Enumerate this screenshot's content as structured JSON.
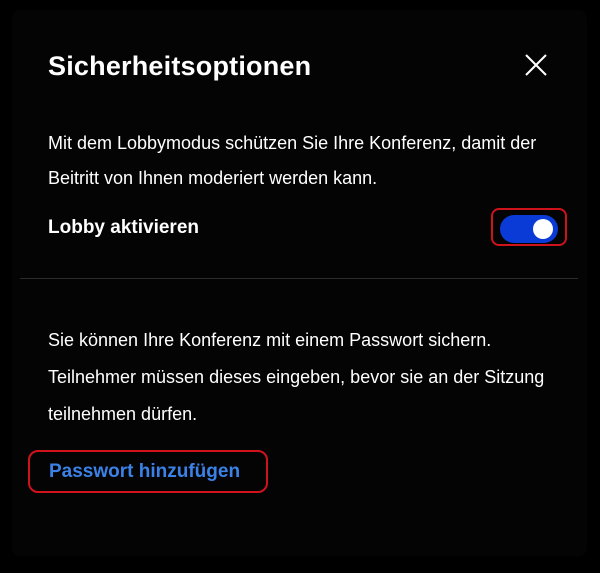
{
  "dialog": {
    "title": "Sicherheitsoptionen",
    "close_icon": "close-icon"
  },
  "lobby": {
    "description": "Mit dem Lobbymodus schützen Sie Ihre Konferenz, damit der Beitritt von Ihnen moderiert werden kann.",
    "toggle_label": "Lobby aktivieren",
    "toggle_on": true
  },
  "password": {
    "description": "Sie können Ihre Konferenz mit einem Passwort sichern. Teilnehmer müssen dieses eingeben, bevor sie an der Sitzung teilnehmen dürfen.",
    "add_label": "Passwort hinzufügen"
  },
  "colors": {
    "accent": "#0a3bd6",
    "link": "#3b82e8",
    "highlight_border": "#d0121b"
  }
}
